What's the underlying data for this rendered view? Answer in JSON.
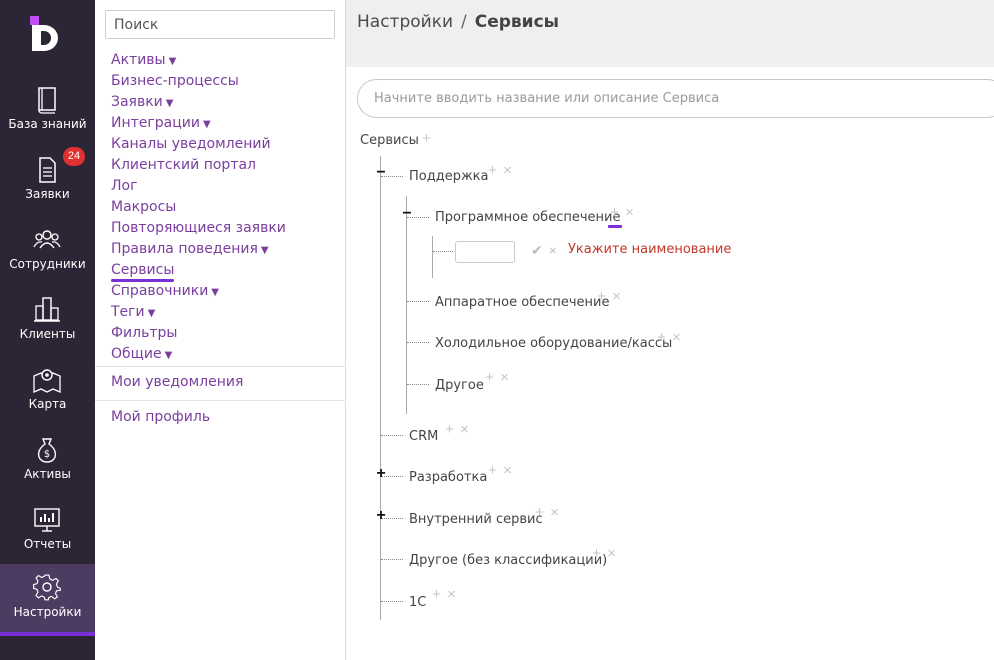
{
  "nav": {
    "items": [
      {
        "label": "База знаний",
        "icon": "book-icon"
      },
      {
        "label": "Заявки",
        "icon": "document-icon",
        "badge": "24"
      },
      {
        "label": "Сотрудники",
        "icon": "people-icon"
      },
      {
        "label": "Клиенты",
        "icon": "building-icon"
      },
      {
        "label": "Карта",
        "icon": "map-icon"
      },
      {
        "label": "Активы",
        "icon": "money-bag-icon"
      },
      {
        "label": "Отчеты",
        "icon": "monitor-chart-icon"
      },
      {
        "label": "Настройки",
        "icon": "gear-icon",
        "active": true
      }
    ]
  },
  "menu": {
    "search_placeholder": "Поиск",
    "items": [
      {
        "label": "Активы",
        "dropdown": true
      },
      {
        "label": "Бизнес-процессы"
      },
      {
        "label": "Заявки",
        "dropdown": true
      },
      {
        "label": "Интеграции",
        "dropdown": true
      },
      {
        "label": "Каналы уведомлений"
      },
      {
        "label": "Клиентский портал"
      },
      {
        "label": "Лог"
      },
      {
        "label": "Макросы"
      },
      {
        "label": "Повторяющиеся заявки"
      },
      {
        "label": "Правила поведения",
        "dropdown": true
      },
      {
        "label": "Сервисы",
        "active": true
      },
      {
        "label": "Справочники",
        "dropdown": true
      },
      {
        "label": "Теги",
        "dropdown": true
      },
      {
        "label": "Фильтры"
      },
      {
        "label": "Общие",
        "dropdown": true
      }
    ],
    "notifications": "Мои уведомления",
    "profile": "Мой профиль",
    "dropdown_glyph": "▼"
  },
  "breadcrumb": {
    "parent": "Настройки",
    "separator": "/",
    "current": "Сервисы"
  },
  "service_search_placeholder": "Начните вводить название или описание Сервиса",
  "tree": {
    "root": "Сервисы",
    "nodes": {
      "support": "Поддержка",
      "software": "Программное обеспечение",
      "hardware": "Аппаратное обеспечение",
      "fridge": "Холодильное оборудование/кассы",
      "other": "Другое",
      "crm": "CRM",
      "dev": "Разработка",
      "internal": "Внутренний сервис",
      "other2": "Другое (без классификации)",
      "onec": "1С"
    },
    "new_item_error": "Укажите наименование",
    "plus": "+",
    "close": "×",
    "collapse": "−",
    "expand": "+",
    "check": "✔"
  }
}
